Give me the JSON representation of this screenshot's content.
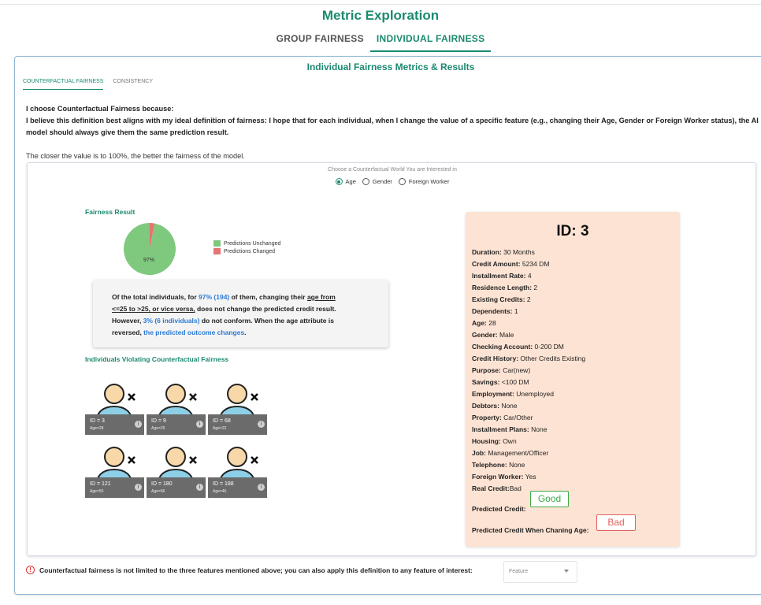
{
  "app": {
    "title": "Metric Exploration"
  },
  "top_tabs": [
    {
      "label": "GROUP FAIRNESS",
      "active": false
    },
    {
      "label": "INDIVIDUAL FAIRNESS",
      "active": true
    }
  ],
  "card": {
    "title": "Individual Fairness Metrics & Results",
    "sub_tabs": [
      {
        "label": "COUNTERFACTUAL FAIRNESS",
        "active": true
      },
      {
        "label": "CONSISTENCY",
        "active": false
      }
    ],
    "reason_line1": "I choose Counterfactual Fairness because:",
    "reason_line2": "I believe this definition best aligns with my ideal definition of fairness: I hope that for each individual, when I change the value of a specific feature (e.g., changing their Age, Gender or Foreign Worker status), the AI",
    "reason_line3": "model should always give them the same prediction result.",
    "closer_text": "The closer the value is to 100%, the better the fairness of the model."
  },
  "counterfactual": {
    "prompt": "Choose a Counterfactual World You are Interested in",
    "options": [
      {
        "label": "Age",
        "checked": true
      },
      {
        "label": "Gender",
        "checked": false
      },
      {
        "label": "Foreign Worker",
        "checked": false
      }
    ]
  },
  "fairness_result": {
    "title": "Fairness Result",
    "pie_label": "97%",
    "legend": [
      {
        "label": "Predictions Unchanged",
        "color": "#7fc97f"
      },
      {
        "label": "Predictions Changed",
        "color": "#e57373"
      }
    ]
  },
  "chart_data": {
    "type": "pie",
    "slices": [
      {
        "label": "Predictions Unchanged",
        "value": 194,
        "percent": 97
      },
      {
        "label": "Predictions Changed",
        "value": 6,
        "percent": 3
      }
    ]
  },
  "summary": {
    "t1": "Of the total individuals, for ",
    "t2": "97% (194)",
    "t3": " of them, changing their ",
    "t4": "age from",
    "t5": "<=25 to >25, or vice versa,",
    "t6": " does not change the predicted credit result.",
    "t7": "However, ",
    "t8": "3% (6 individuals)",
    "t9": " do not conform. When the age attribute is",
    "t10": "reversed, ",
    "t11": "the predicted outcome changes",
    "t12": "."
  },
  "violations": {
    "title": "Individuals Violating Counterfactual Fairness",
    "items": [
      {
        "id": "ID = 3",
        "age": "Age=28"
      },
      {
        "id": "ID = 9",
        "age": "Age=25"
      },
      {
        "id": "ID = 68",
        "age": "Age=22"
      },
      {
        "id": "ID = 121",
        "age": "Age=50"
      },
      {
        "id": "ID = 180",
        "age": "Age=66"
      },
      {
        "id": "ID = 188",
        "age": "Age=46"
      }
    ]
  },
  "detail": {
    "id_title": "ID: 3",
    "rows": [
      {
        "k": "Duration:",
        "v": " 30 Months"
      },
      {
        "k": "Credit Amount:",
        "v": " 5234 DM"
      },
      {
        "k": "Installment Rate:",
        "v": " 4"
      },
      {
        "k": "Residence Length:",
        "v": " 2"
      },
      {
        "k": "Existing Credits:",
        "v": " 2"
      },
      {
        "k": "Dependents:",
        "v": " 1"
      },
      {
        "k": "Age:",
        "v": " 28"
      },
      {
        "k": "Gender:",
        "v": " Male"
      },
      {
        "k": "Checking Account:",
        "v": " 0-200 DM"
      },
      {
        "k": "Credit History:",
        "v": " Other Credits Existing"
      },
      {
        "k": "Purpose:",
        "v": " Car(new)"
      },
      {
        "k": "Savings:",
        "v": " <100 DM"
      },
      {
        "k": "Employment:",
        "v": " Unemployed"
      },
      {
        "k": "Debtors:",
        "v": " None"
      },
      {
        "k": "Property:",
        "v": " Car/Other"
      },
      {
        "k": "Installment Plans:",
        "v": " None"
      },
      {
        "k": "Housing:",
        "v": " Own"
      },
      {
        "k": "Job:",
        "v": " Management/Officer"
      },
      {
        "k": "Telephone:",
        "v": " None"
      },
      {
        "k": "Foreign Worker:",
        "v": " Yes"
      },
      {
        "k": "Real Credit:",
        "v": "Bad"
      }
    ],
    "predicted_label": "Predicted Credit:",
    "predicted_value": "Good",
    "changing_label": "Predicted Credit When Chaning Age:",
    "changing_value": "Bad"
  },
  "bottom": {
    "note": "Counterfactual fairness is not limited to the three features mentioned above; you can also apply this definition to any feature of interest:",
    "select_placeholder": "Feature"
  }
}
